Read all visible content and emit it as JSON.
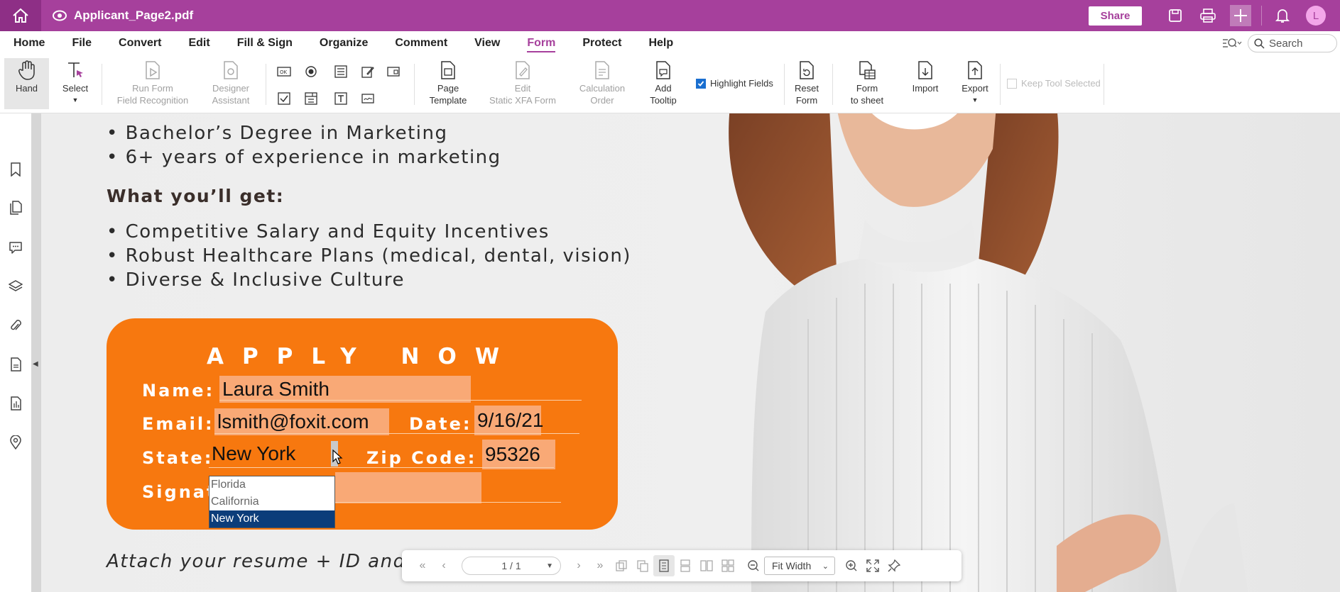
{
  "titlebar": {
    "doc_title": "Applicant_Page2.pdf",
    "share_label": "Share",
    "avatar_initial": "L"
  },
  "menu": {
    "items": [
      {
        "label": "Home"
      },
      {
        "label": "File"
      },
      {
        "label": "Convert"
      },
      {
        "label": "Edit"
      },
      {
        "label": "Fill & Sign"
      },
      {
        "label": "Organize"
      },
      {
        "label": "Comment"
      },
      {
        "label": "View"
      },
      {
        "label": "Form",
        "active": true
      },
      {
        "label": "Protect"
      },
      {
        "label": "Help"
      }
    ],
    "search_placeholder": "Search"
  },
  "ribbon": {
    "hand": "Hand",
    "select": "Select",
    "run_form_1": "Run Form",
    "run_form_2": "Field Recognition",
    "designer_1": "Designer",
    "designer_2": "Assistant",
    "page_template_1": "Page",
    "page_template_2": "Template",
    "edit_xfa_1": "Edit",
    "edit_xfa_2": "Static XFA Form",
    "calc_1": "Calculation",
    "calc_2": "Order",
    "add_tooltip_1": "Add",
    "add_tooltip_2": "Tooltip",
    "highlight_fields": "Highlight Fields",
    "reset_1": "Reset",
    "reset_2": "Form",
    "form_sheet_1": "Form",
    "form_sheet_2": "to sheet",
    "import": "Import",
    "export": "Export",
    "keep_tool": "Keep Tool Selected"
  },
  "document": {
    "bullets_top": [
      "Bachelor’s Degree in Marketing",
      "6+ years of experience in marketing"
    ],
    "heading": "What you’ll get:",
    "bullets_get": [
      "Competitive Salary and Equity Incentives",
      "Robust Healthcare Plans (medical, dental, vision)",
      "Diverse & Inclusive Culture"
    ],
    "attach_text": "Attach your resume + ID and s"
  },
  "form": {
    "title": "APPLY NOW",
    "name_label": "Name:",
    "name_value": "Laura Smith",
    "email_label": "Email:",
    "email_value": "lsmith@foxit.com",
    "date_label": "Date:",
    "date_value": "9/16/21",
    "state_label": "State:",
    "state_value": "New York",
    "zip_label": "Zip Code:",
    "zip_value": "95326",
    "signature_label": "Signat",
    "state_options": [
      {
        "label": "Florida"
      },
      {
        "label": "California"
      },
      {
        "label": "New York",
        "selected": true
      }
    ]
  },
  "navbar": {
    "page_indicator": "1 / 1",
    "zoom_mode": "Fit Width"
  }
}
